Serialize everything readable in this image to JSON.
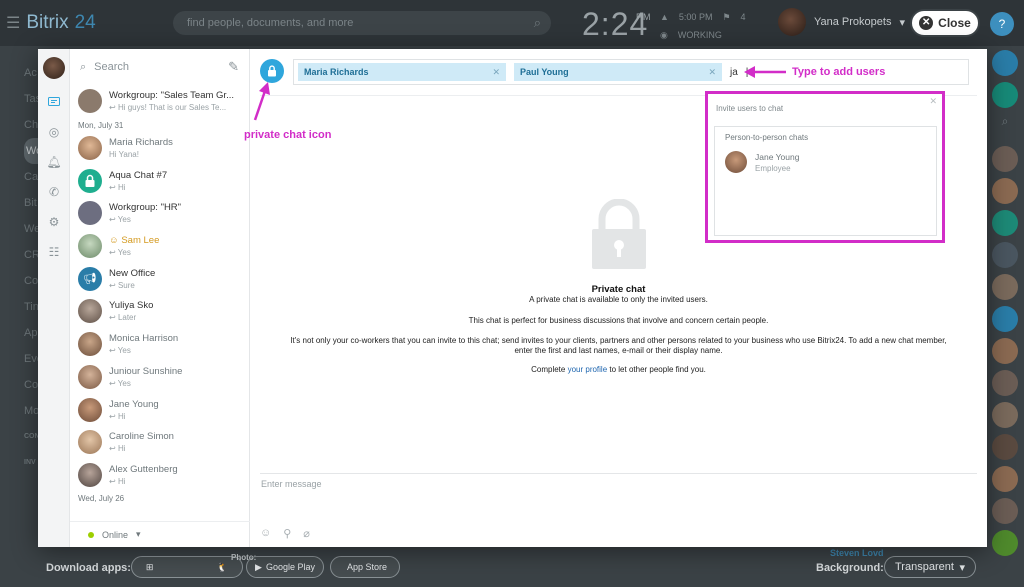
{
  "topbar": {
    "logo": "Bitrix",
    "logo_num": "24",
    "search_placeholder": "find people, documents, and more",
    "clock": "2:24",
    "clock_ampm": "PM",
    "meta_time": "5:00 PM",
    "meta_flag": "4",
    "status": "WORKING",
    "user_name": "Yana Prokopets",
    "close_label": "Close",
    "help": "?"
  },
  "leftnav": [
    "Ac",
    "Tas",
    "Ch",
    "Wo",
    "Ca",
    "Bit",
    "We",
    "CR",
    "Co",
    "Tin",
    "Ap",
    "Eve",
    "Co",
    "Mo",
    "CON",
    "INV"
  ],
  "messenger": {
    "search_label": "Search",
    "chats": [
      {
        "name": "Workgroup: \"Sales Team Gr...",
        "last": "Hi guys! That is our Sales Te...",
        "av": "group"
      },
      {
        "date": "Mon, July 31"
      },
      {
        "name": "Maria Richards",
        "last": "Hi Yana!",
        "av": "person",
        "grey": true
      },
      {
        "name": "Aqua Chat #7",
        "last": "Hi",
        "av": "lock"
      },
      {
        "name": "Workgroup: \"HR\"",
        "last": "Yes",
        "av": "group"
      },
      {
        "name": "Sam Lee",
        "last": "Yes",
        "av": "person",
        "orange": true
      },
      {
        "name": "New Office",
        "last": "Sure",
        "av": "megaphone"
      },
      {
        "name": "Yuliya Sko",
        "last": "Later",
        "av": "person"
      },
      {
        "name": "Monica Harrison",
        "last": "Yes",
        "av": "person",
        "grey": true
      },
      {
        "name": "Juniour Sunshine",
        "last": "Yes",
        "av": "person",
        "grey": true
      },
      {
        "name": "Jane Young",
        "last": "Hi",
        "av": "person",
        "grey": true
      },
      {
        "name": "Caroline Simon",
        "last": "Hi",
        "av": "person",
        "grey": true
      },
      {
        "name": "Alex Guttenberg",
        "last": "Hi",
        "av": "person",
        "grey": true
      },
      {
        "date": "Wed, July 26"
      }
    ],
    "status_label": "Online",
    "to_tokens": [
      "Maria Richards",
      "Paul Young"
    ],
    "to_typed": "ja",
    "invite": {
      "title": "Invite users to chat",
      "group": "Person-to-person chats",
      "person_name": "Jane Young",
      "person_role": "Employee"
    },
    "private": {
      "title": "Private chat",
      "line1": "A private chat is available to only the invited users.",
      "line2": "This chat is perfect for business discussions that involve and concern certain people.",
      "line3a": "It's not only your co-workers that you can invite to this chat; send invites to your clients, partners and other persons related to your business who use Bitrix24. To add a new chat member,",
      "line3b": "enter the first and last names, e-mail or their display name.",
      "line4_pre": "Complete ",
      "line4_link": "your profile",
      "line4_post": " to let other people find you."
    },
    "composer_placeholder": "Enter message"
  },
  "annotations": {
    "type_to_add": "Type to add users",
    "private_icon": "private chat icon"
  },
  "bottombar": {
    "download_label": "Download apps:",
    "google_play": "Google Play",
    "app_store": "App Store",
    "photo_label": "Photo:",
    "background_label": "Background:",
    "background_value": "Transparent",
    "steven": "Steven Lovd"
  },
  "colors": {
    "accent": "#2fa6dc",
    "annotation": "#d22dc8",
    "token_bg": "#cfeaf7"
  }
}
